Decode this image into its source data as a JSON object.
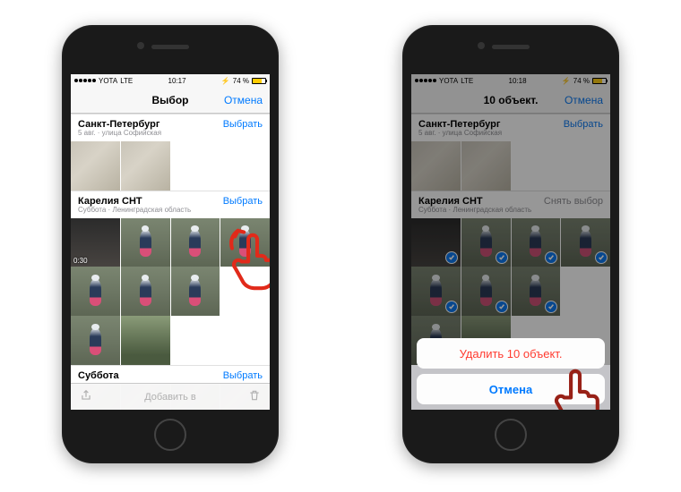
{
  "status": {
    "carrier": "YOTA",
    "network": "LTE",
    "time_left": "10:17",
    "time_right": "10:18",
    "battery_pct": "74 %",
    "charging_glyph": "⚡"
  },
  "left": {
    "nav_title": "Выбор",
    "nav_cancel": "Отмена",
    "section1": {
      "title": "Санкт-Петербург",
      "subtitle": "5 авг. · улица Софийская",
      "action": "Выбрать"
    },
    "section2": {
      "title": "Карелия СНТ",
      "subtitle": "Суббота · Ленинградская область",
      "action": "Выбрать"
    },
    "video_duration": "0:30",
    "section3": {
      "title": "Суббота",
      "action": "Выбрать"
    },
    "toolbar_center": "Добавить в"
  },
  "right": {
    "nav_title": "10 объект.",
    "nav_cancel": "Отмена",
    "section1": {
      "title": "Санкт-Петербург",
      "subtitle": "5 авг. · улица Софийская",
      "action": "Выбрать"
    },
    "section2": {
      "title": "Карелия СНТ",
      "subtitle": "Суббота · Ленинградская область",
      "action": "Снять выбор"
    },
    "sheet_delete": "Удалить 10 объект.",
    "sheet_cancel": "Отмена"
  },
  "colors": {
    "ios_blue": "#007aff",
    "ios_red": "#ff3b30",
    "hand_stroke": "#e12a1a"
  }
}
